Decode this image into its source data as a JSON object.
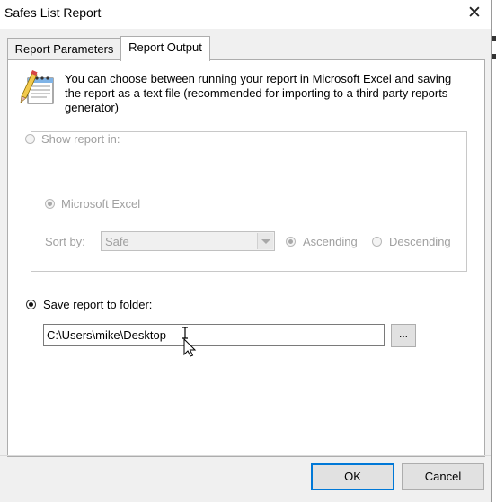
{
  "window": {
    "title": "Safes List Report",
    "close_label": "✕"
  },
  "tabs": [
    {
      "label": "Report Parameters"
    },
    {
      "label": "Report Output"
    }
  ],
  "info": {
    "text": "You can choose between running your report in Microsoft Excel and saving the report as a text file (recommended for importing to a third party reports generator)"
  },
  "show_report": {
    "label": "Show report in:",
    "selected": false,
    "enabled": false
  },
  "excel": {
    "label": "Microsoft Excel",
    "selected": true,
    "enabled": false
  },
  "sort": {
    "label": "Sort by:",
    "value": "Safe"
  },
  "ascending": {
    "label": "Ascending",
    "selected": true
  },
  "descending": {
    "label": "Descending",
    "selected": false
  },
  "save_folder": {
    "label": "Save report to folder:",
    "selected": true,
    "path": "C:\\Users\\mike\\Desktop",
    "browse_label": "..."
  },
  "buttons": {
    "ok": "OK",
    "cancel": "Cancel"
  },
  "colors": {
    "accent": "#0078d7",
    "disabled_text": "#a0a0a0"
  }
}
